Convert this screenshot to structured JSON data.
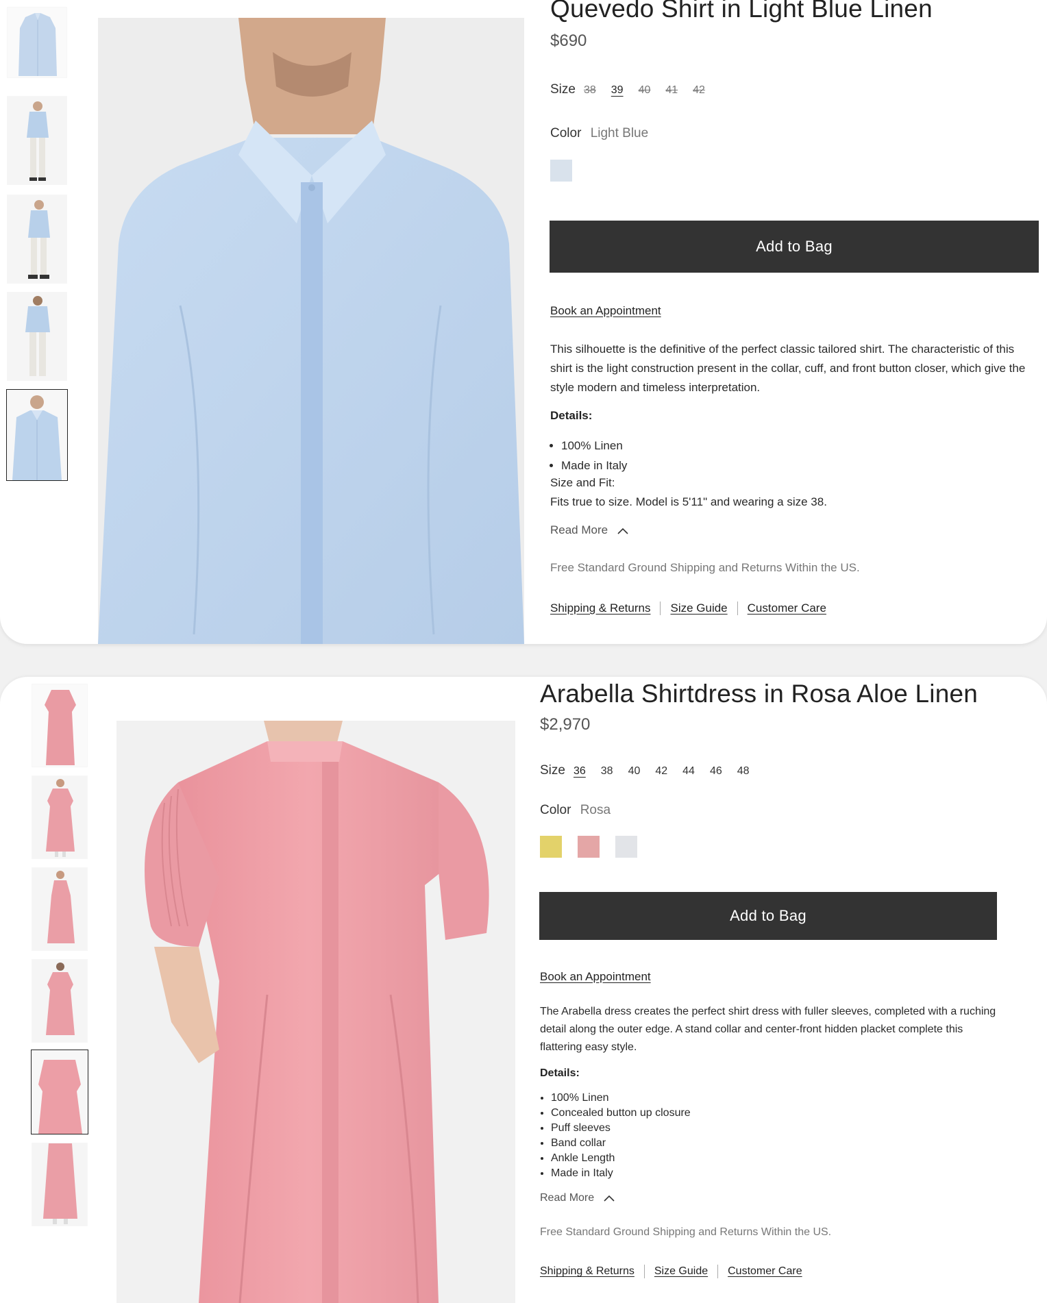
{
  "products": [
    {
      "title": "Quevedo Shirt in Light Blue Linen",
      "price": "$690",
      "size_label": "Size",
      "sizes": [
        {
          "label": "38",
          "state": "unavailable"
        },
        {
          "label": "39",
          "state": "selected"
        },
        {
          "label": "40",
          "state": "unavailable"
        },
        {
          "label": "41",
          "state": "unavailable"
        },
        {
          "label": "42",
          "state": "unavailable"
        }
      ],
      "color_label": "Color",
      "color_value": "Light Blue",
      "swatches": [
        "#d9e2ec"
      ],
      "cta": "Add to Bag",
      "appointment": "Book an Appointment",
      "description": "This silhouette is the definitive of the perfect classic tailored shirt. The characteristic of this shirt is the light construction present in the collar, cuff, and front button closer, which give the style modern and timeless interpretation.",
      "details_heading": "Details:",
      "details": [
        "100% Linen",
        "Made in Italy"
      ],
      "size_fit_heading": "Size and Fit:",
      "size_fit_text": "Fits true to size. Model is 5'11\" and wearing a size 38.",
      "read_more": "Read More",
      "shipping_note": "Free Standard Ground Shipping and Returns Within the US.",
      "links": [
        "Shipping & Returns",
        "Size Guide",
        "Customer Care"
      ],
      "thumbnail_count": 5,
      "active_thumbnail": 5,
      "garment_color": "#bcd3ec"
    },
    {
      "title": "Arabella Shirtdress in Rosa Aloe Linen",
      "price": "$2,970",
      "size_label": "Size",
      "sizes": [
        {
          "label": "36",
          "state": "selected"
        },
        {
          "label": "38",
          "state": "available"
        },
        {
          "label": "40",
          "state": "available"
        },
        {
          "label": "42",
          "state": "available"
        },
        {
          "label": "44",
          "state": "available"
        },
        {
          "label": "46",
          "state": "available"
        },
        {
          "label": "48",
          "state": "available"
        }
      ],
      "color_label": "Color",
      "color_value": "Rosa",
      "swatches": [
        "#e3d26a",
        "#e4a6a6",
        "#e2e4e8"
      ],
      "cta": "Add to Bag",
      "appointment": "Book an Appointment",
      "description": "The Arabella dress creates the perfect shirt dress with fuller sleeves, completed with a ruching detail along the outer edge. A stand collar and center-front hidden placket complete this flattering easy style.",
      "details_heading": "Details:",
      "details": [
        "100% Linen",
        "Concealed button up closure",
        "Puff sleeves",
        "Band collar",
        "Ankle Length",
        "Made in Italy"
      ],
      "read_more": "Read More",
      "shipping_note": "Free Standard Ground Shipping and Returns Within the US.",
      "links": [
        "Shipping & Returns",
        "Size Guide",
        "Customer Care"
      ],
      "thumbnail_count": 6,
      "active_thumbnail": 5,
      "garment_color": "#ec9ea6"
    }
  ]
}
